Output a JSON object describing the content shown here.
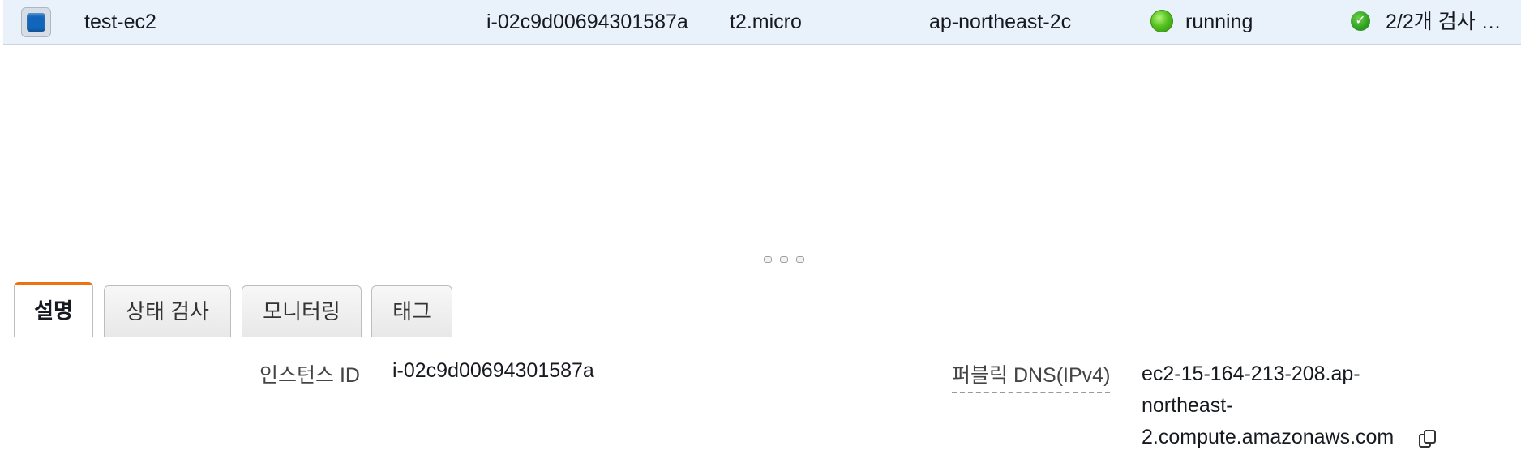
{
  "instance_row": {
    "name": "test-ec2",
    "instance_id": "i-02c9d00694301587a",
    "instance_type": "t2.micro",
    "availability_zone": "ap-northeast-2c",
    "state": "running",
    "status_checks": "2/2개 검사 …",
    "state_color": "#3fae1a"
  },
  "tabs": [
    {
      "label": "설명",
      "active": true
    },
    {
      "label": "상태 검사",
      "active": false
    },
    {
      "label": "모니터링",
      "active": false
    },
    {
      "label": "태그",
      "active": false
    }
  ],
  "description": {
    "instance_id_label": "인스턴스 ID",
    "instance_id_value": "i-02c9d00694301587a",
    "public_dns_label": "퍼블릭 DNS(IPv4)",
    "public_dns_line1": "ec2-15-164-213-208.ap-",
    "public_dns_line2": "northeast-",
    "public_dns_line3": "2.compute.amazonaws.com"
  },
  "icons": {
    "checkbox": "checkbox-selected-icon",
    "state": "running-status-icon",
    "status_check": "check-circle-icon",
    "copy": "copy-icon",
    "resize": "resize-grip-icon"
  },
  "colors": {
    "selected_row": "#e9f1fb",
    "active_tab_accent": "#ec7211"
  }
}
